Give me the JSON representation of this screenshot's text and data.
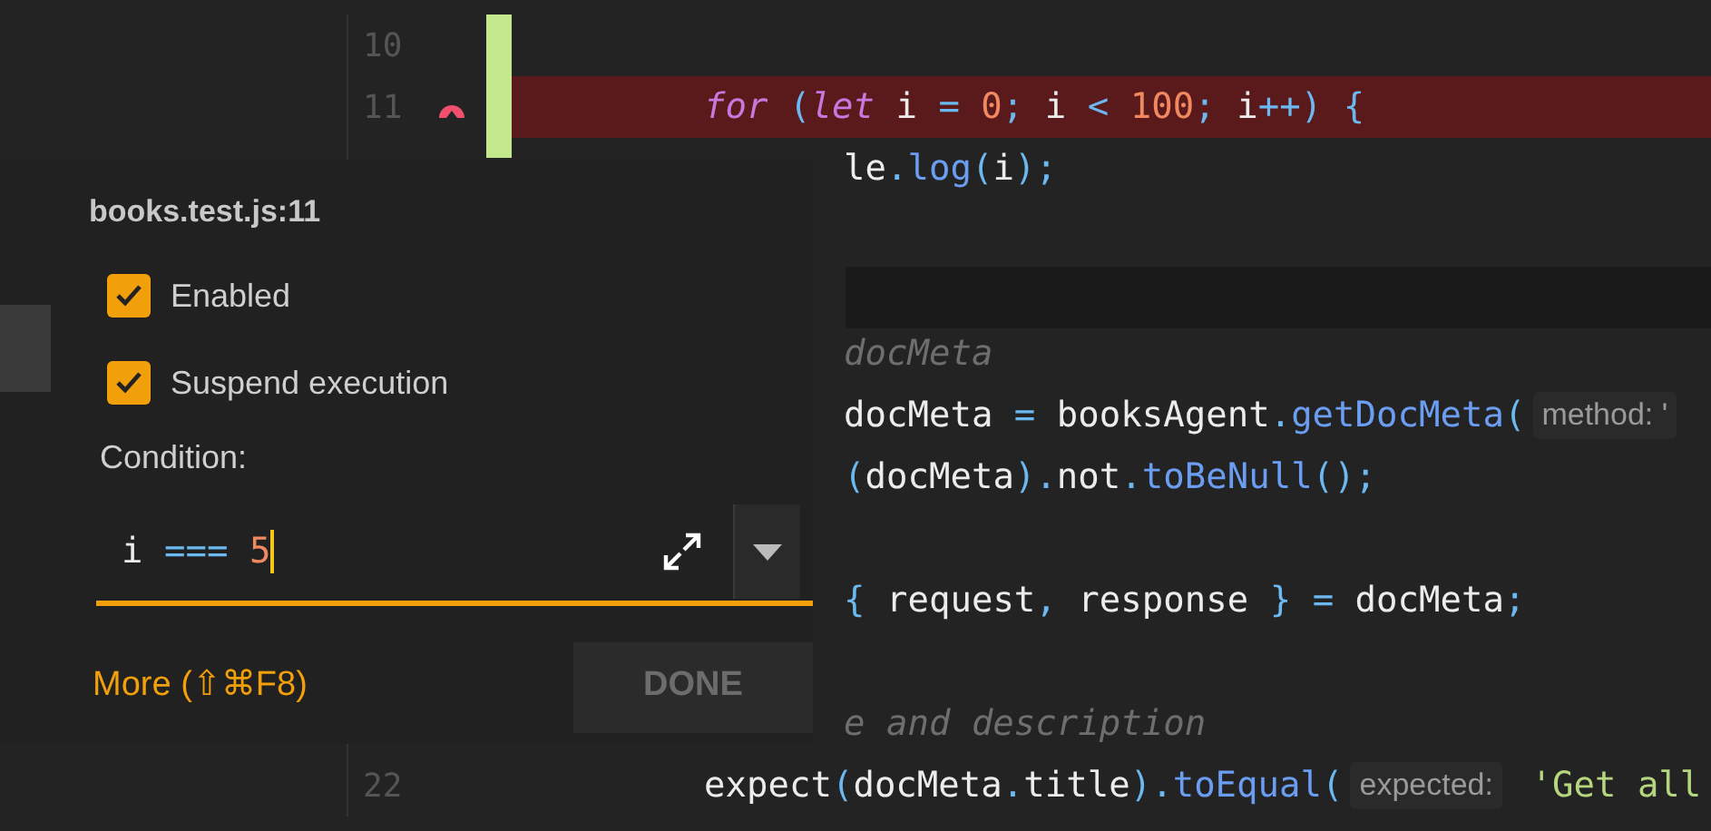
{
  "editor": {
    "lines": [
      {
        "kind": "code",
        "number": "10",
        "changed": true
      },
      {
        "kind": "code",
        "number": "11",
        "changed": true,
        "breakpoint": true,
        "highlighted": true,
        "segments": [
          {
            "kind": "code",
            "tokens": [
              {
                "text": "for",
                "kind": "keyword"
              },
              {
                "text": " (",
                "kind": "punct"
              },
              {
                "text": "let",
                "kind": "keyword"
              },
              {
                "text": " i ",
                "kind": "plain"
              },
              {
                "text": "=",
                "kind": "punct"
              },
              {
                "text": " 0",
                "kind": "number"
              },
              {
                "text": ";",
                "kind": "punct"
              },
              {
                "text": " i ",
                "kind": "plain"
              },
              {
                "text": "<",
                "kind": "punct"
              },
              {
                "text": " 100",
                "kind": "number"
              },
              {
                "text": ";",
                "kind": "punct"
              },
              {
                "text": " i",
                "kind": "plain"
              },
              {
                "text": "++)",
                "kind": "punct"
              },
              {
                "text": " {",
                "kind": "punct"
              }
            ]
          }
        ]
      },
      {
        "kind": "code",
        "segments": [
          {
            "kind": "code",
            "tokens": [
              {
                "text": "le",
                "kind": "plain"
              },
              {
                "text": ".",
                "kind": "punct"
              },
              {
                "text": "log",
                "kind": "function"
              },
              {
                "text": "(",
                "kind": "punct"
              },
              {
                "text": "i",
                "kind": "plain"
              },
              {
                "text": ");",
                "kind": "punct"
              }
            ]
          }
        ]
      },
      {
        "kind": "blank"
      },
      {
        "kind": "shaded"
      },
      {
        "kind": "code",
        "segments": [
          {
            "kind": "code",
            "tokens": [
              {
                "text": "docMeta",
                "kind": "comment"
              }
            ]
          }
        ]
      },
      {
        "kind": "code",
        "segments": [
          {
            "kind": "code",
            "tokens": [
              {
                "text": "docMeta ",
                "kind": "plain"
              },
              {
                "text": "=",
                "kind": "punct"
              },
              {
                "text": " booksAgent",
                "kind": "plain"
              },
              {
                "text": ".",
                "kind": "punct"
              },
              {
                "text": "getDocMeta",
                "kind": "function"
              },
              {
                "text": "(",
                "kind": "punct"
              }
            ]
          },
          {
            "kind": "hint",
            "text": "method: '"
          }
        ]
      },
      {
        "kind": "code",
        "segments": [
          {
            "kind": "code",
            "tokens": [
              {
                "text": "(",
                "kind": "punct"
              },
              {
                "text": "docMeta",
                "kind": "plain"
              },
              {
                "text": ").",
                "kind": "punct"
              },
              {
                "text": "not",
                "kind": "plain"
              },
              {
                "text": ".",
                "kind": "punct"
              },
              {
                "text": "toBeNull",
                "kind": "function"
              },
              {
                "text": "();",
                "kind": "punct"
              }
            ]
          }
        ]
      },
      {
        "kind": "blank"
      },
      {
        "kind": "code",
        "segments": [
          {
            "kind": "code",
            "tokens": [
              {
                "text": "{",
                "kind": "punct"
              },
              {
                "text": " request",
                "kind": "plain"
              },
              {
                "text": ",",
                "kind": "punct"
              },
              {
                "text": " response ",
                "kind": "plain"
              },
              {
                "text": "}",
                "kind": "punct"
              },
              {
                "text": " =",
                "kind": "punct"
              },
              {
                "text": " docMeta",
                "kind": "plain"
              },
              {
                "text": ";",
                "kind": "punct"
              }
            ]
          }
        ]
      },
      {
        "kind": "blank"
      },
      {
        "kind": "code",
        "segments": [
          {
            "kind": "code",
            "tokens": [
              {
                "text": "e and description",
                "kind": "comment"
              }
            ]
          }
        ]
      },
      {
        "kind": "code",
        "number": "22",
        "segments": [
          {
            "kind": "code",
            "tokens": [
              {
                "text": "expect",
                "kind": "plain"
              },
              {
                "text": "(",
                "kind": "punct"
              },
              {
                "text": "docMeta",
                "kind": "plain"
              },
              {
                "text": ".",
                "kind": "punct"
              },
              {
                "text": "title",
                "kind": "plain"
              },
              {
                "text": ").",
                "kind": "punct"
              },
              {
                "text": "toEqual",
                "kind": "function"
              },
              {
                "text": "(",
                "kind": "punct"
              }
            ]
          },
          {
            "kind": "hint",
            "text": "expected:"
          },
          {
            "kind": "code",
            "tokens": [
              {
                "text": " 'Get all",
                "kind": "string"
              }
            ]
          }
        ]
      }
    ]
  },
  "breakpoint_popup": {
    "title": "books.test.js:11",
    "options": [
      {
        "label": "Enabled",
        "checked": true
      },
      {
        "label": "Suspend execution",
        "checked": true
      }
    ],
    "condition": {
      "label": "Condition:",
      "focused": true,
      "tokens": [
        {
          "text": "i ",
          "kind": "plain"
        },
        {
          "text": "===",
          "kind": "punct"
        },
        {
          "text": " 5",
          "kind": "number"
        }
      ]
    },
    "more_link": "More (⇧⌘F8)",
    "done_button": {
      "label": "DONE",
      "disabled": true
    }
  }
}
